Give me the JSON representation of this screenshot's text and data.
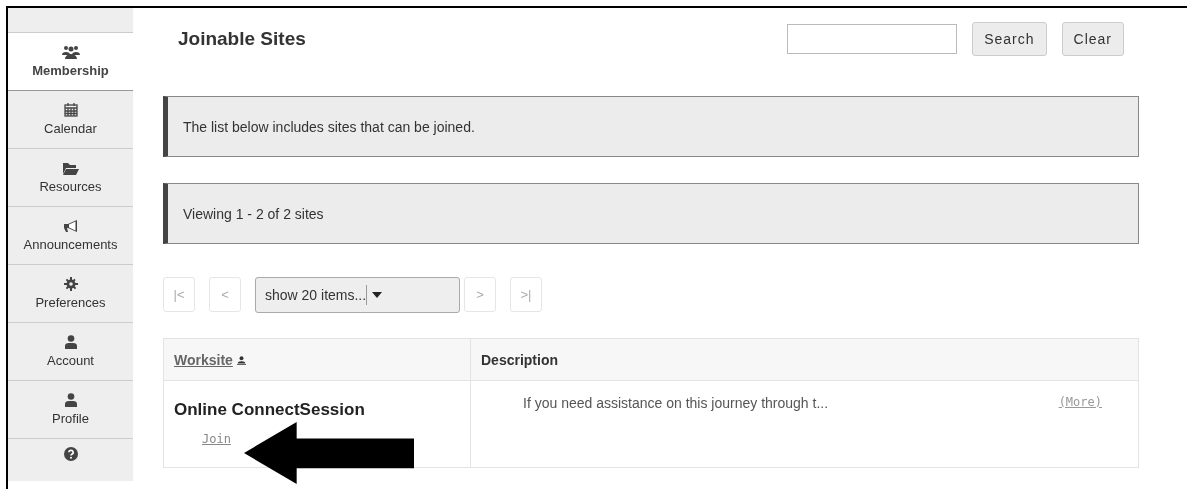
{
  "sidebar": {
    "items": [
      {
        "kind": "group",
        "label": "Membership",
        "selected": true
      },
      {
        "kind": "calendar",
        "label": "Calendar",
        "selected": false
      },
      {
        "kind": "folder",
        "label": "Resources",
        "selected": false
      },
      {
        "kind": "megaphone",
        "label": "Announcements",
        "selected": false
      },
      {
        "kind": "gear",
        "label": "Preferences",
        "selected": false
      },
      {
        "kind": "user",
        "label": "Account",
        "selected": false
      },
      {
        "kind": "user",
        "label": "Profile",
        "selected": false
      },
      {
        "kind": "help",
        "selected": false
      }
    ]
  },
  "main": {
    "title": "Joinable Sites",
    "search_buttons": [
      "Search",
      "Clear"
    ],
    "notices": [
      "The list below includes sites that can be joined.",
      "Viewing 1 - 2 of 2 sites"
    ],
    "pager": {
      "first": "|<",
      "previous": "<",
      "page_size": "show 20 items...",
      "next": ">",
      "last": ">|"
    },
    "table": {
      "columns": [
        {
          "label": "Worksite",
          "sorted": true
        },
        {
          "label": "Description",
          "sorted": false
        }
      ],
      "rows": [
        {
          "worksite": "Online ConnectSession",
          "action": "Join",
          "description": "If you need assistance on this journey through t...",
          "more": "(More)"
        }
      ]
    }
  }
}
